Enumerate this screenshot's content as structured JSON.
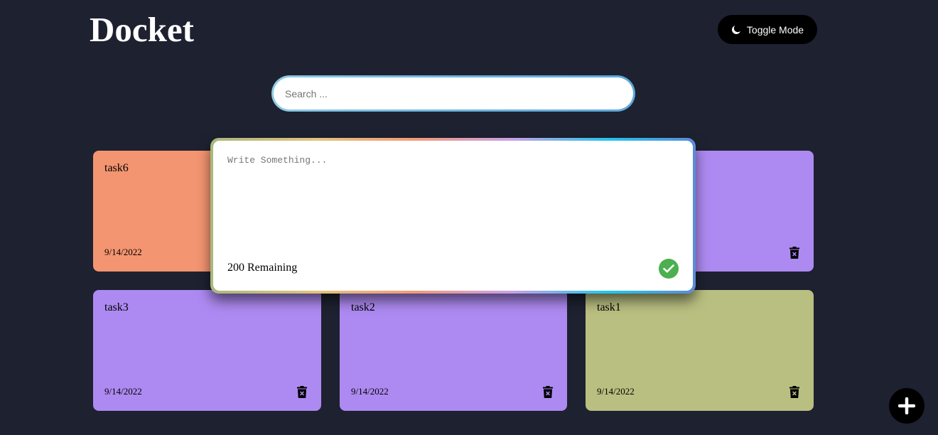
{
  "header": {
    "title": "Docket",
    "toggle_label": "Toggle Mode",
    "toggle_icon": "moon-icon"
  },
  "search": {
    "placeholder": "Search ...",
    "value": ""
  },
  "note_editor": {
    "placeholder": "Write Something...",
    "value": "",
    "remaining": "200 Remaining",
    "save_icon": "check-icon"
  },
  "notes": [
    {
      "title": "task6",
      "date": "9/14/2022",
      "color": "#f49571",
      "delete_icon": "trash-icon"
    },
    {
      "title": "",
      "date": "",
      "color": "#ad8af1",
      "delete_icon": "trash-icon"
    },
    {
      "title": "task3",
      "date": "9/14/2022",
      "color": "#ad8af1",
      "delete_icon": "trash-icon"
    },
    {
      "title": "task2",
      "date": "9/14/2022",
      "color": "#ad8af1",
      "delete_icon": "trash-icon"
    },
    {
      "title": "task1",
      "date": "9/14/2022",
      "color": "#b9bf80",
      "delete_icon": "trash-icon"
    }
  ],
  "fab": {
    "icon": "plus-icon"
  },
  "colors": {
    "background": "#1e2130",
    "button_dark": "#000000",
    "save_green": "#4caf50"
  }
}
